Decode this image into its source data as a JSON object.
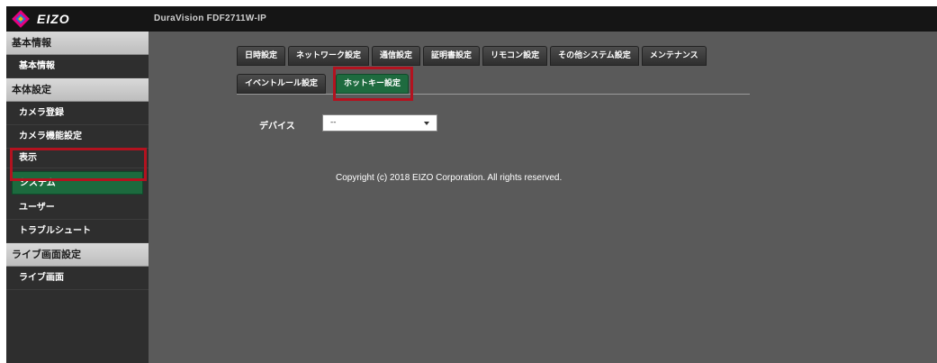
{
  "header": {
    "logo_text": "EIZO",
    "model_name": "DuraVision FDF2711W-IP"
  },
  "sidebar": {
    "sections": [
      {
        "label": "基本情報",
        "items": [
          "基本情報"
        ]
      },
      {
        "label": "本体設定",
        "items": [
          "カメラ登録",
          "カメラ機能設定",
          "表示",
          "システム",
          "ユーザー",
          "トラブルシュート"
        ]
      },
      {
        "label": "ライブ画面設定",
        "items": [
          "ライブ画面"
        ]
      }
    ],
    "active_item": "システム"
  },
  "tabs": {
    "row1": [
      "日時設定",
      "ネットワーク設定",
      "通信設定",
      "証明書設定",
      "リモコン設定",
      "その他システム設定",
      "メンテナンス"
    ],
    "row2": [
      "イベントルール設定",
      "ホットキー設定"
    ],
    "active": "ホットキー設定"
  },
  "form": {
    "device_label": "デバイス",
    "device_value": "--"
  },
  "footer": {
    "copyright": "Copyright (c) 2018 EIZO Corporation. All rights reserved."
  },
  "colors": {
    "accent_green": "#1e6b3f",
    "highlight_red": "#b3121f",
    "background": "#5a5a5a"
  }
}
